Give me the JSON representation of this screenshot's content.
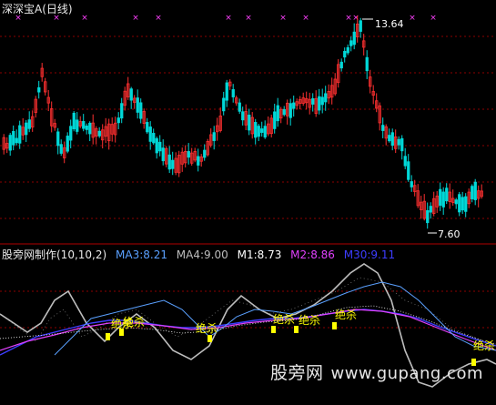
{
  "header": {
    "stock_name": "深深宝A",
    "period": "(日线)"
  },
  "price_annotations": {
    "high_label": "13.64",
    "low_label": "7.60"
  },
  "indicator": {
    "name": "股旁网制作(10,10,2)",
    "ma3": {
      "label": "MA3:8.21",
      "color": "#5aa0ff"
    },
    "ma4": {
      "label": "MA4:9.00",
      "color": "#bdbdbd"
    },
    "m1": {
      "label": "M1:8.73",
      "color": "#ffffff"
    },
    "m2": {
      "label": "M2:8.86",
      "color": "#e040fb"
    },
    "m30": {
      "label": "M30:9.11",
      "color": "#3d3dff"
    }
  },
  "signal_text": "绝杀",
  "watermark": {
    "cn": "股旁网",
    "site": "www.gupang.com"
  },
  "colors": {
    "background": "#000000",
    "up_candle": "#ff3030",
    "down_candle": "#00d8d8",
    "grid": "#8b0000",
    "marker": "#ff40ff",
    "signal": "#ffff00"
  }
}
